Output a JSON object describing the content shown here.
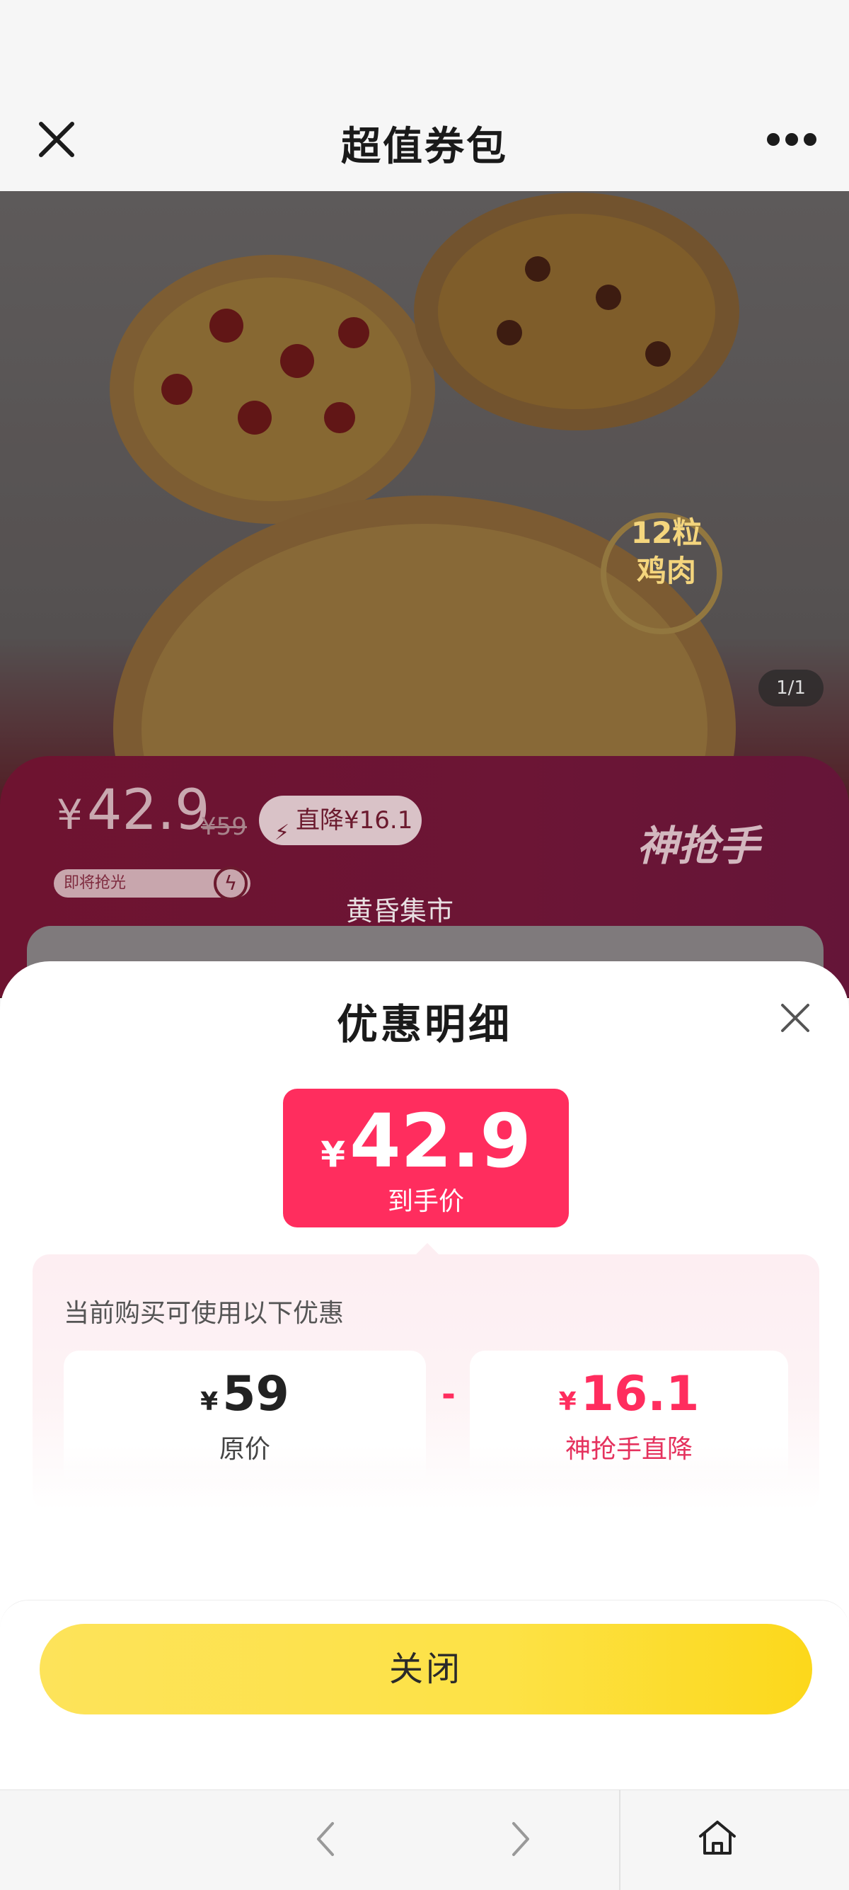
{
  "nav": {
    "title": "超值券包",
    "close_icon": "close-icon",
    "more_icon": "more-dots-icon"
  },
  "hero": {
    "page_indicator": "1/1",
    "stamp_line1": "12粒",
    "stamp_line2": "鸡肉",
    "price_yen": "¥",
    "price": "42.9",
    "original_price": "¥59",
    "drop_badge": "直降¥16.1",
    "brand": "神抢手",
    "soon_text": "即将抢光",
    "market_label": "黄昏集市"
  },
  "sheet": {
    "title": "优惠明细",
    "final_yen": "¥",
    "final_price": "42.9",
    "final_label": "到手价",
    "discount_title": "当前购买可使用以下优惠",
    "original": {
      "yen": "¥",
      "value": "59",
      "label": "原价"
    },
    "operator": "-",
    "discount": {
      "yen": "¥",
      "value": "16.1",
      "label": "神抢手直降"
    },
    "close_button": "关闭"
  },
  "colors": {
    "accent": "#ff2d5e",
    "button_yellow": "#fde246",
    "hero_overlay": "#6e1330"
  },
  "toolbar": {
    "back_icon": "chevron-left-icon",
    "forward_icon": "chevron-right-icon",
    "home_icon": "home-icon"
  }
}
